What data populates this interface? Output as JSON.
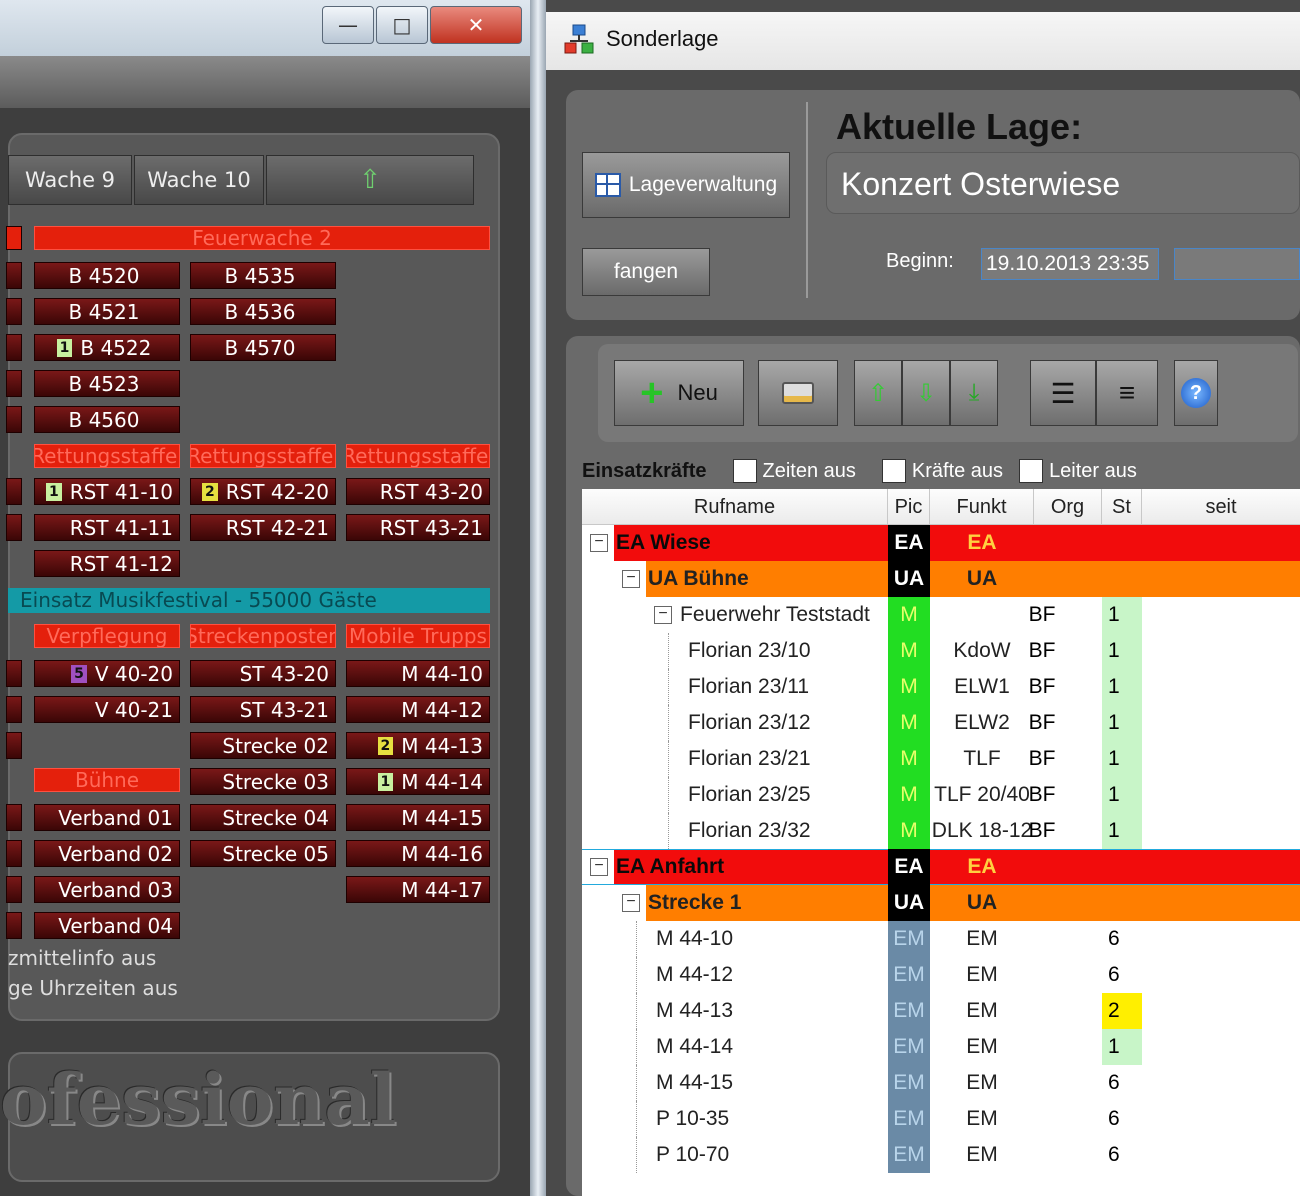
{
  "left_window": {
    "tabs": [
      "Wache 9",
      "Wache 10"
    ],
    "feuerwache_header": "Feuerwache 2",
    "col1_units": [
      {
        "label": "B 4520"
      },
      {
        "label": "B 4521"
      },
      {
        "label": "B 4522",
        "badge": "1"
      },
      {
        "label": "B 4523"
      },
      {
        "label": "B 4560"
      }
    ],
    "col2_units": [
      {
        "label": "B 4535"
      },
      {
        "label": "B 4536"
      },
      {
        "label": "B 4570"
      }
    ],
    "rettung_headers": [
      "Rettungsstaffel",
      "Rettungsstaffel",
      "Rettungsstaffel"
    ],
    "rst_col1": [
      {
        "label": "RST 41-10",
        "badge": "1"
      },
      {
        "label": "RST 41-11"
      },
      {
        "label": "RST 41-12"
      }
    ],
    "rst_col2": [
      {
        "label": "RST 42-20",
        "badge": "2"
      },
      {
        "label": "RST 42-21"
      }
    ],
    "rst_col3": [
      {
        "label": "RST 43-20"
      },
      {
        "label": "RST 43-21"
      }
    ],
    "band_text": "Einsatz Musikfestival - 55000 Gäste",
    "group_headers": [
      "Verpflegung",
      "Streckenposten",
      "Mobile Trupps"
    ],
    "verpf_units": [
      {
        "label": "V 40-20",
        "badge": "5"
      },
      {
        "label": "V 40-21"
      }
    ],
    "buehne_header": "Bühne",
    "verband_units": [
      "Verband 01",
      "Verband 02",
      "Verband 03",
      "Verband 04"
    ],
    "strecken_units": [
      "ST 43-20",
      "ST 43-21",
      "Strecke 02",
      "Strecke 03",
      "Strecke 04",
      "Strecke 05"
    ],
    "mobile_units": [
      {
        "label": "M 44-10"
      },
      {
        "label": "M 44-12"
      },
      {
        "label": "M 44-13",
        "badge": "2"
      },
      {
        "label": "M 44-14",
        "badge": "1"
      },
      {
        "label": "M 44-15"
      },
      {
        "label": "M 44-16"
      },
      {
        "label": "M 44-17"
      }
    ],
    "option_lines": [
      "zmittelinfo aus",
      "ge Uhrzeiten aus"
    ],
    "watermark": "ofessional"
  },
  "right_window": {
    "title": "Sonderlage",
    "lageverwaltung": "Lageverwaltung",
    "fangen": "fangen",
    "aktuelle_lage_heading": "Aktuelle Lage:",
    "lage_name": "Konzert Osterwiese",
    "beginn_label": "Beginn:",
    "beginn_value": "19.10.2013 23:35",
    "neu": "Neu",
    "einsatzkraefte_label": "Einsatzkräfte",
    "checkboxes": [
      "Zeiten aus",
      "Kräfte aus",
      "Leiter aus"
    ],
    "columns": [
      "Rufname",
      "Pic",
      "Funkt",
      "Org",
      "St",
      "seit"
    ],
    "rows": [
      {
        "rufname": "EA Wiese",
        "pic": "EA",
        "funkt": "EA",
        "org": "",
        "st": "",
        "type": "ea",
        "indent": 0,
        "expander": true
      },
      {
        "rufname": "UA Bühne",
        "pic": "UA",
        "funkt": "UA",
        "org": "",
        "st": "",
        "type": "ua",
        "indent": 1,
        "expander": true
      },
      {
        "rufname": "Feuerwehr Teststadt",
        "pic": "M",
        "funkt": "",
        "org": "BF",
        "st": "1",
        "type": "unit",
        "indent": 2,
        "expander": true
      },
      {
        "rufname": "Florian 23/10",
        "pic": "M",
        "funkt": "KdoW",
        "org": "BF",
        "st": "1",
        "type": "unit",
        "indent": 3
      },
      {
        "rufname": "Florian 23/11",
        "pic": "M",
        "funkt": "ELW1",
        "org": "BF",
        "st": "1",
        "type": "unit",
        "indent": 3
      },
      {
        "rufname": "Florian 23/12",
        "pic": "M",
        "funkt": "ELW2",
        "org": "BF",
        "st": "1",
        "type": "unit",
        "indent": 3
      },
      {
        "rufname": "Florian 23/21",
        "pic": "M",
        "funkt": "TLF",
        "org": "BF",
        "st": "1",
        "type": "unit",
        "indent": 3
      },
      {
        "rufname": "Florian 23/25",
        "pic": "M",
        "funkt": "TLF 20/40",
        "org": "BF",
        "st": "1",
        "type": "unit",
        "indent": 3
      },
      {
        "rufname": "Florian 23/32",
        "pic": "M",
        "funkt": "DLK 18-12",
        "org": "BF",
        "st": "1",
        "type": "unit",
        "indent": 3
      },
      {
        "rufname": "EA Anfahrt",
        "pic": "EA",
        "funkt": "EA",
        "org": "",
        "st": "",
        "type": "ea",
        "indent": 0,
        "expander": true
      },
      {
        "rufname": "Strecke 1",
        "pic": "UA",
        "funkt": "UA",
        "org": "",
        "st": "",
        "type": "ua",
        "indent": 1,
        "expander": true
      },
      {
        "rufname": "M 44-10",
        "pic": "EM",
        "funkt": "EM",
        "org": "",
        "st": "6",
        "type": "em",
        "indent": 2
      },
      {
        "rufname": "M 44-12",
        "pic": "EM",
        "funkt": "EM",
        "org": "",
        "st": "6",
        "type": "em",
        "indent": 2
      },
      {
        "rufname": "M 44-13",
        "pic": "EM",
        "funkt": "EM",
        "org": "",
        "st": "2",
        "type": "em",
        "indent": 2
      },
      {
        "rufname": "M 44-14",
        "pic": "EM",
        "funkt": "EM",
        "org": "",
        "st": "1",
        "type": "em",
        "indent": 2
      },
      {
        "rufname": "M 44-15",
        "pic": "EM",
        "funkt": "EM",
        "org": "",
        "st": "6",
        "type": "em",
        "indent": 2
      },
      {
        "rufname": "P 10-35",
        "pic": "EM",
        "funkt": "EM",
        "org": "",
        "st": "6",
        "type": "em",
        "indent": 2
      },
      {
        "rufname": "P 10-70",
        "pic": "EM",
        "funkt": "EM",
        "org": "",
        "st": "6",
        "type": "em",
        "indent": 2
      }
    ],
    "colors": {
      "ea": "#f20c0c",
      "ua": "#ff7e00",
      "pic_green": "#22dd22",
      "pic_em": "#6a8aa6",
      "st_green": "#c8f5c8",
      "st_yellow": "#ffef00"
    }
  }
}
